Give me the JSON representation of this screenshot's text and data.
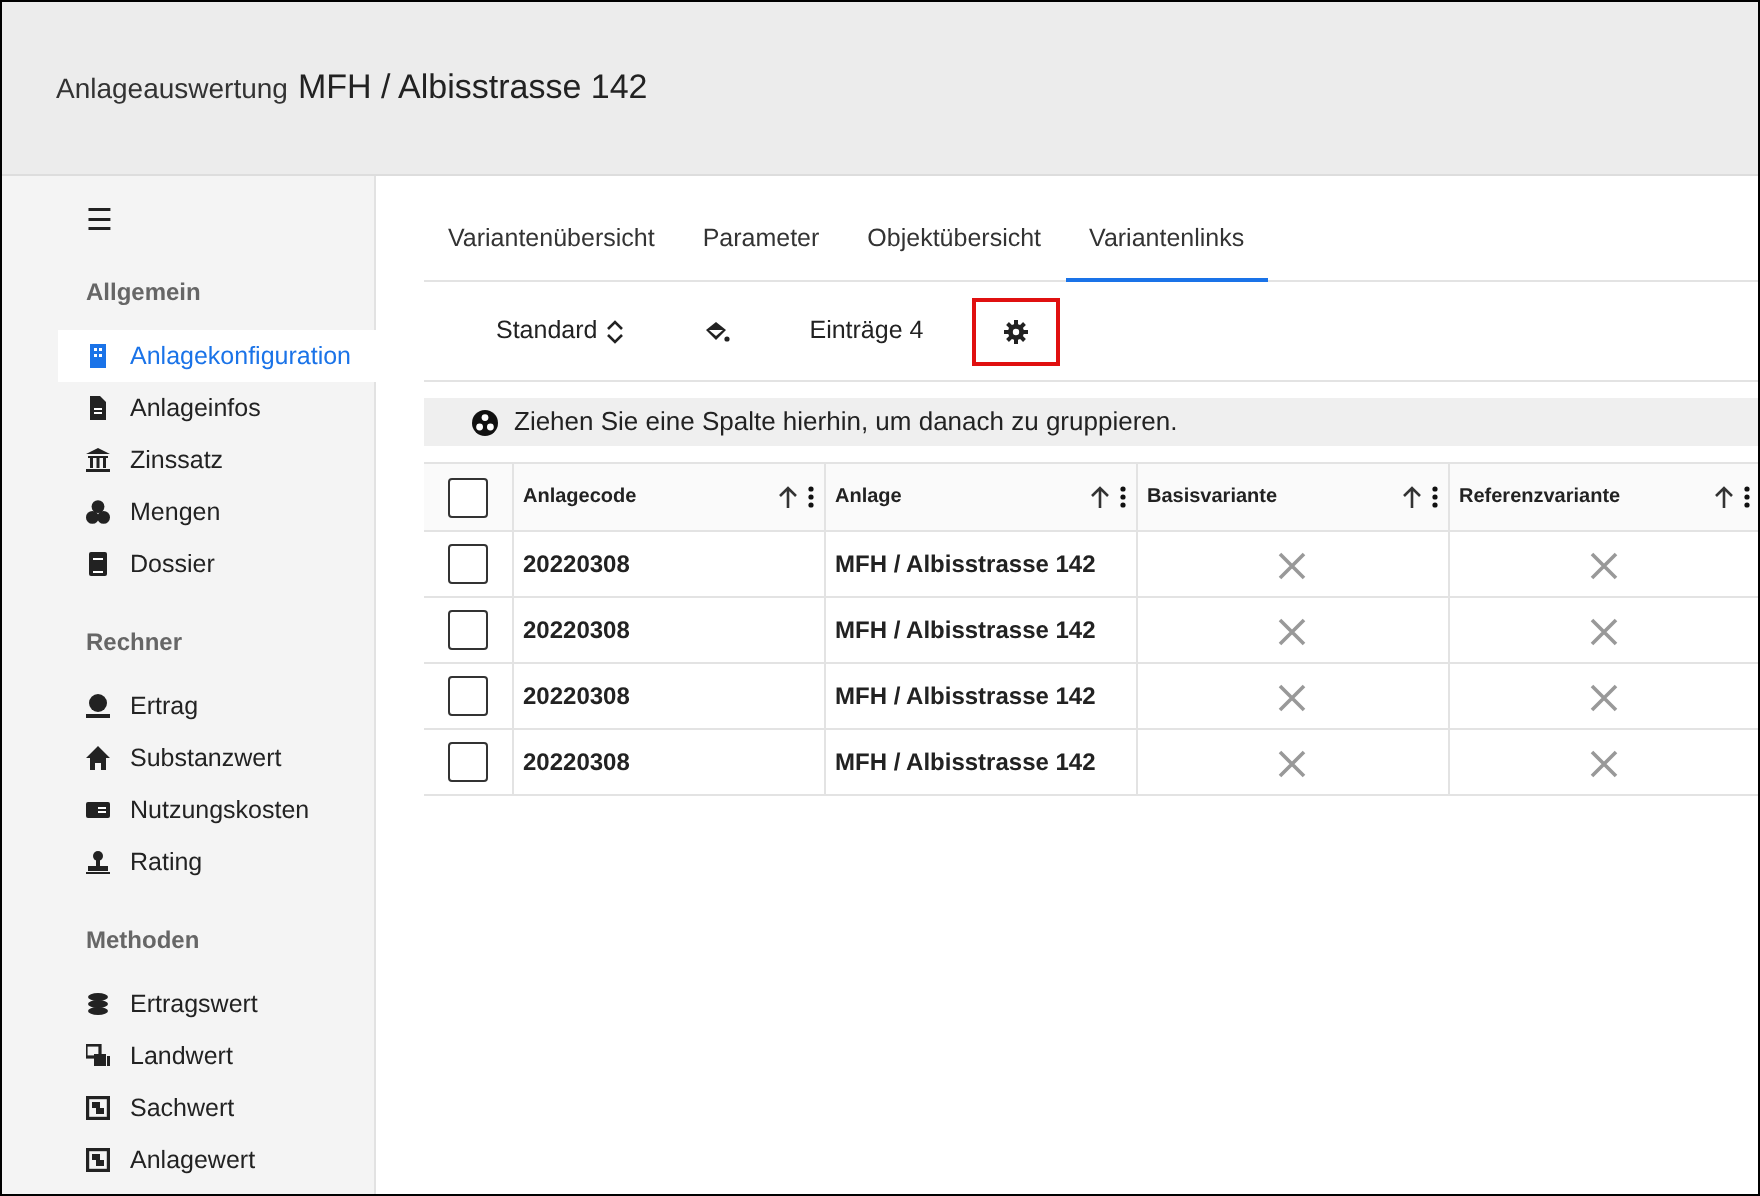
{
  "header": {
    "label": "Anlageauswertung",
    "title": "MFH / Albisstrasse 142"
  },
  "sidebar": {
    "menu_icon": "☰",
    "sections": [
      {
        "title": "Allgemein",
        "items": [
          {
            "label": "Anlagekonfiguration",
            "selected": true
          },
          {
            "label": "Anlageinfos",
            "selected": false
          },
          {
            "label": "Zinssatz",
            "selected": false
          },
          {
            "label": "Mengen",
            "selected": false
          },
          {
            "label": "Dossier",
            "selected": false
          }
        ]
      },
      {
        "title": "Rechner",
        "items": [
          {
            "label": "Ertrag",
            "selected": false
          },
          {
            "label": "Substanzwert",
            "selected": false
          },
          {
            "label": "Nutzungskosten",
            "selected": false
          },
          {
            "label": "Rating",
            "selected": false
          }
        ]
      },
      {
        "title": "Methoden",
        "items": [
          {
            "label": "Ertragswert",
            "selected": false
          },
          {
            "label": "Landwert",
            "selected": false
          },
          {
            "label": "Sachwert",
            "selected": false
          },
          {
            "label": "Anlagewert",
            "selected": false
          }
        ]
      }
    ]
  },
  "tabs": [
    {
      "label": "Variantenübersicht",
      "selected": false
    },
    {
      "label": "Parameter",
      "selected": false
    },
    {
      "label": "Objektübersicht",
      "selected": false
    },
    {
      "label": "Variantenlinks",
      "selected": true
    }
  ],
  "toolbar": [
    {
      "kind": "select",
      "label": "Standard",
      "highlighted": false
    },
    {
      "kind": "paint",
      "highlighted": false
    },
    {
      "kind": "text",
      "label": "Einträge 4",
      "highlighted": false
    },
    {
      "kind": "settings",
      "highlighted": true
    }
  ],
  "group_panel": {
    "text": "Ziehen Sie eine Spalte hierhin, um danach zu gruppieren."
  },
  "table": {
    "select_all_checked": false,
    "columns": [
      "Anlagecode",
      "Anlage",
      "Basisvariante",
      "Referenzvariante"
    ],
    "rows": [
      {
        "checked": false,
        "anlagecode": "20220308",
        "anlage": "MFH / Albisstrasse 142",
        "basisvariante": false,
        "referenzvariante": false
      },
      {
        "checked": false,
        "anlagecode": "20220308",
        "anlage": "MFH / Albisstrasse 142",
        "basisvariante": false,
        "referenzvariante": false
      },
      {
        "checked": false,
        "anlagecode": "20220308",
        "anlage": "MFH / Albisstrasse 142",
        "basisvariante": false,
        "referenzvariante": false
      },
      {
        "checked": false,
        "anlagecode": "20220308",
        "anlage": "MFH / Albisstrasse 142",
        "basisvariante": false,
        "referenzvariante": false
      }
    ]
  }
}
